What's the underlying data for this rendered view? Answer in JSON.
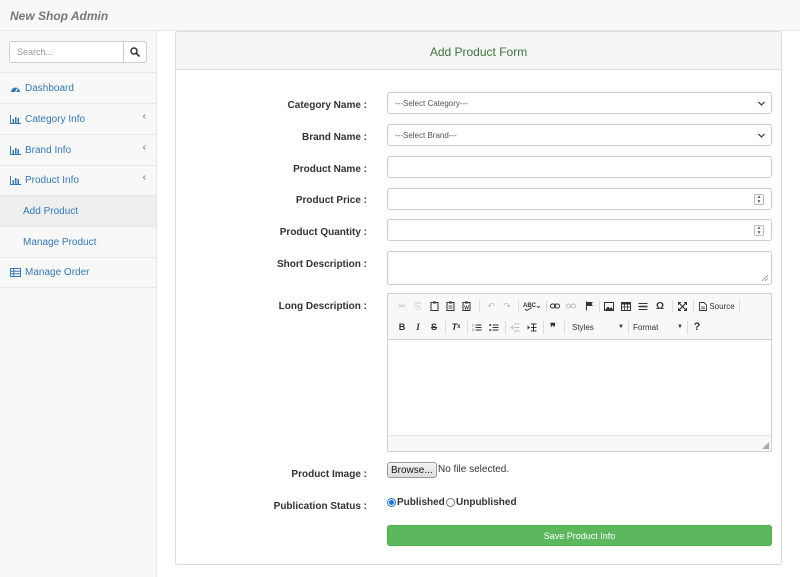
{
  "app": {
    "brand": "New Shop Admin"
  },
  "sidebar": {
    "search_placeholder": "Search...",
    "items": [
      {
        "label": "Dashboard",
        "icon": "dashboard-icon"
      },
      {
        "label": "Category Info",
        "icon": "bar-chart-icon"
      },
      {
        "label": "Brand Info",
        "icon": "bar-chart-icon"
      },
      {
        "label": "Product Info",
        "icon": "bar-chart-icon"
      },
      {
        "label": "Add Product",
        "active": true
      },
      {
        "label": "Manage Product"
      },
      {
        "label": "Manage Order",
        "icon": "table-icon"
      }
    ]
  },
  "form": {
    "title": "Add Product Form",
    "category_label": "Category Name :",
    "category_value": "---Select Category---",
    "brand_label": "Brand Name :",
    "brand_value": "---Select Brand---",
    "name_label": "Product Name :",
    "price_label": "Product Price :",
    "quantity_label": "Product Quantity :",
    "short_desc_label": "Short Description :",
    "long_desc_label": "Long Description :",
    "editor": {
      "source_label": "Source",
      "styles_label": "Styles",
      "format_label": "Format",
      "help_label": "?"
    },
    "image_label": "Product Image :",
    "browse_label": "Browse...",
    "file_status": "No file selected.",
    "status_label": "Publication Status :",
    "status_options": [
      "Published",
      "Unpublished"
    ],
    "selected_status": "Published",
    "save_label": "Save Product Info"
  },
  "colors": {
    "link": "#337ab7",
    "title": "#3c763d",
    "save": "#5cb85c"
  }
}
